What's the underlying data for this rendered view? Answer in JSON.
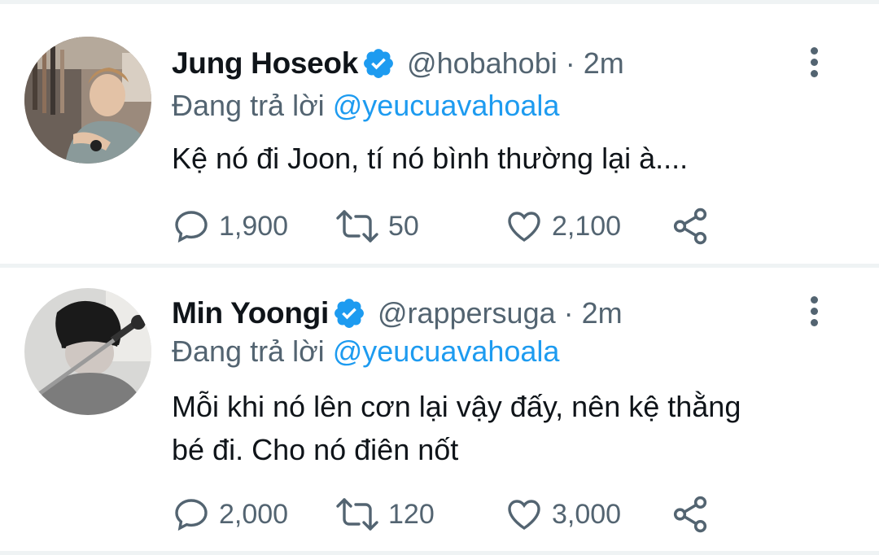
{
  "tweets": [
    {
      "name": "Jung Hoseok",
      "handle": "@hobahobi",
      "separator": "·",
      "time": "2m",
      "reply_prefix": "Đang trả lời",
      "reply_to": "@yeucuavahoala",
      "text": "Kệ nó đi Joon, tí nó bình thường lại à....",
      "stats": {
        "replies": "1,900",
        "retweets": "50",
        "likes": "2,100"
      }
    },
    {
      "name": "Min Yoongi",
      "handle": "@rappersuga",
      "separator": "·",
      "time": "2m",
      "reply_prefix": "Đang trả lời",
      "reply_to": "@yeucuavahoala",
      "text": "Mỗi khi nó lên cơn lại vậy đấy, nên kệ thằng bé đi. Cho nó điên nốt",
      "stats": {
        "replies": "2,000",
        "retweets": "120",
        "likes": "3,000"
      }
    }
  ],
  "colors": {
    "text": "#0f1419",
    "secondary": "#536471",
    "accent": "#1d9bf0",
    "divider": "#eff3f4"
  },
  "icons": [
    "verified-badge-icon",
    "more-options-icon",
    "reply-icon",
    "retweet-icon",
    "like-icon",
    "share-icon"
  ]
}
